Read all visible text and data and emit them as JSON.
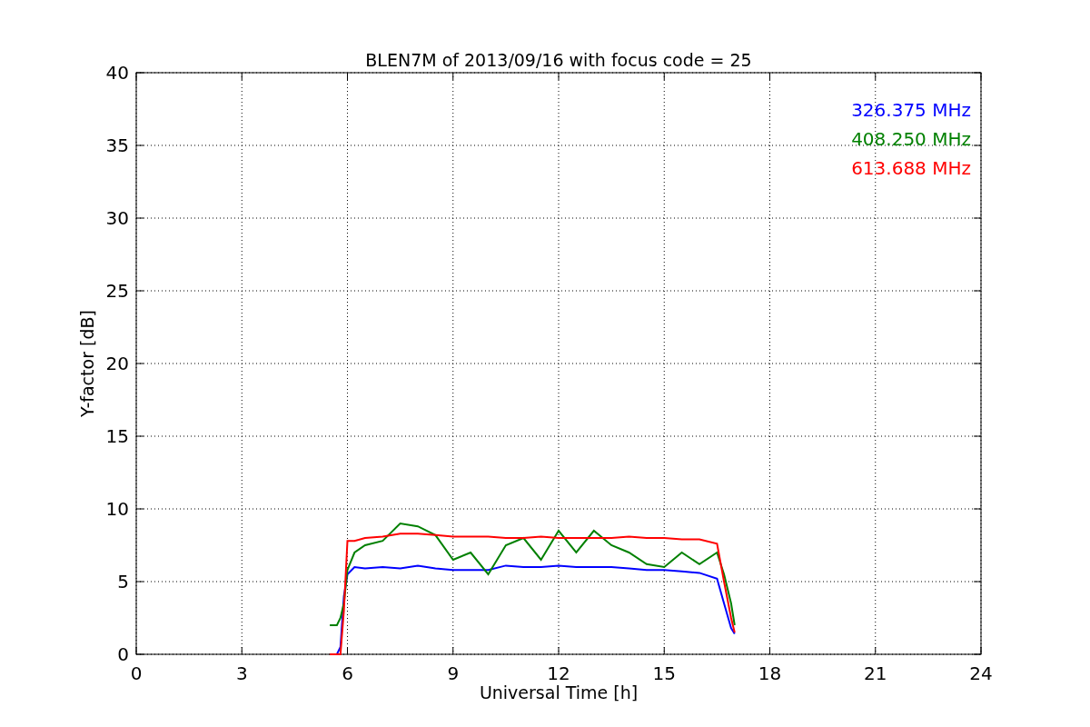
{
  "chart": {
    "chart_data": {
      "type": "line",
      "title": "BLEN7M of 2013/09/16 with focus code = 25",
      "xlabel": "Universal Time [h]",
      "ylabel": "Y-factor [dB]",
      "x": [
        5.5,
        5.7,
        5.8,
        5.9,
        6,
        6.2,
        6.5,
        7,
        7.5,
        8,
        8.5,
        9,
        9.5,
        10,
        10.5,
        11,
        11.5,
        12,
        12.5,
        13,
        13.5,
        14,
        14.5,
        15,
        15.5,
        16,
        16.5,
        16.7,
        16.9,
        17.0
      ],
      "series": [
        {
          "name": "326.375 MHz",
          "color": "#0000ff",
          "values": [
            0,
            0,
            0.5,
            4,
            5.5,
            6,
            5.9,
            6,
            5.9,
            6.1,
            5.9,
            5.8,
            5.8,
            5.8,
            6.1,
            6,
            6,
            6.1,
            6,
            6,
            6,
            5.9,
            5.8,
            5.8,
            5.7,
            5.6,
            5.2,
            3.5,
            1.8,
            1.4
          ]
        },
        {
          "name": "408.250 MHz",
          "color": "#008000",
          "values": [
            2,
            2,
            2.5,
            3.5,
            5.8,
            7,
            7.5,
            7.8,
            9,
            8.8,
            8.2,
            6.5,
            7,
            5.5,
            7.5,
            8,
            6.5,
            8.5,
            7,
            8.5,
            7.5,
            7,
            6.2,
            6,
            7,
            6.2,
            7,
            5.5,
            3.5,
            2
          ]
        },
        {
          "name": "613.688 MHz",
          "color": "#ff0000",
          "values": [
            0,
            0,
            0,
            3,
            7.8,
            7.8,
            8,
            8.1,
            8.3,
            8.3,
            8.2,
            8.1,
            8.1,
            8.1,
            8,
            8,
            8.1,
            8,
            8,
            8,
            8,
            8.1,
            8,
            8,
            7.9,
            7.9,
            7.6,
            5,
            2.5,
            1.5
          ]
        }
      ],
      "xlim": [
        0,
        24
      ],
      "ylim": [
        0,
        40
      ],
      "xticks": [
        0,
        3,
        6,
        9,
        12,
        15,
        18,
        21,
        24
      ],
      "yticks": [
        0,
        5,
        10,
        15,
        20,
        25,
        30,
        35,
        40
      ],
      "grid": true
    }
  }
}
